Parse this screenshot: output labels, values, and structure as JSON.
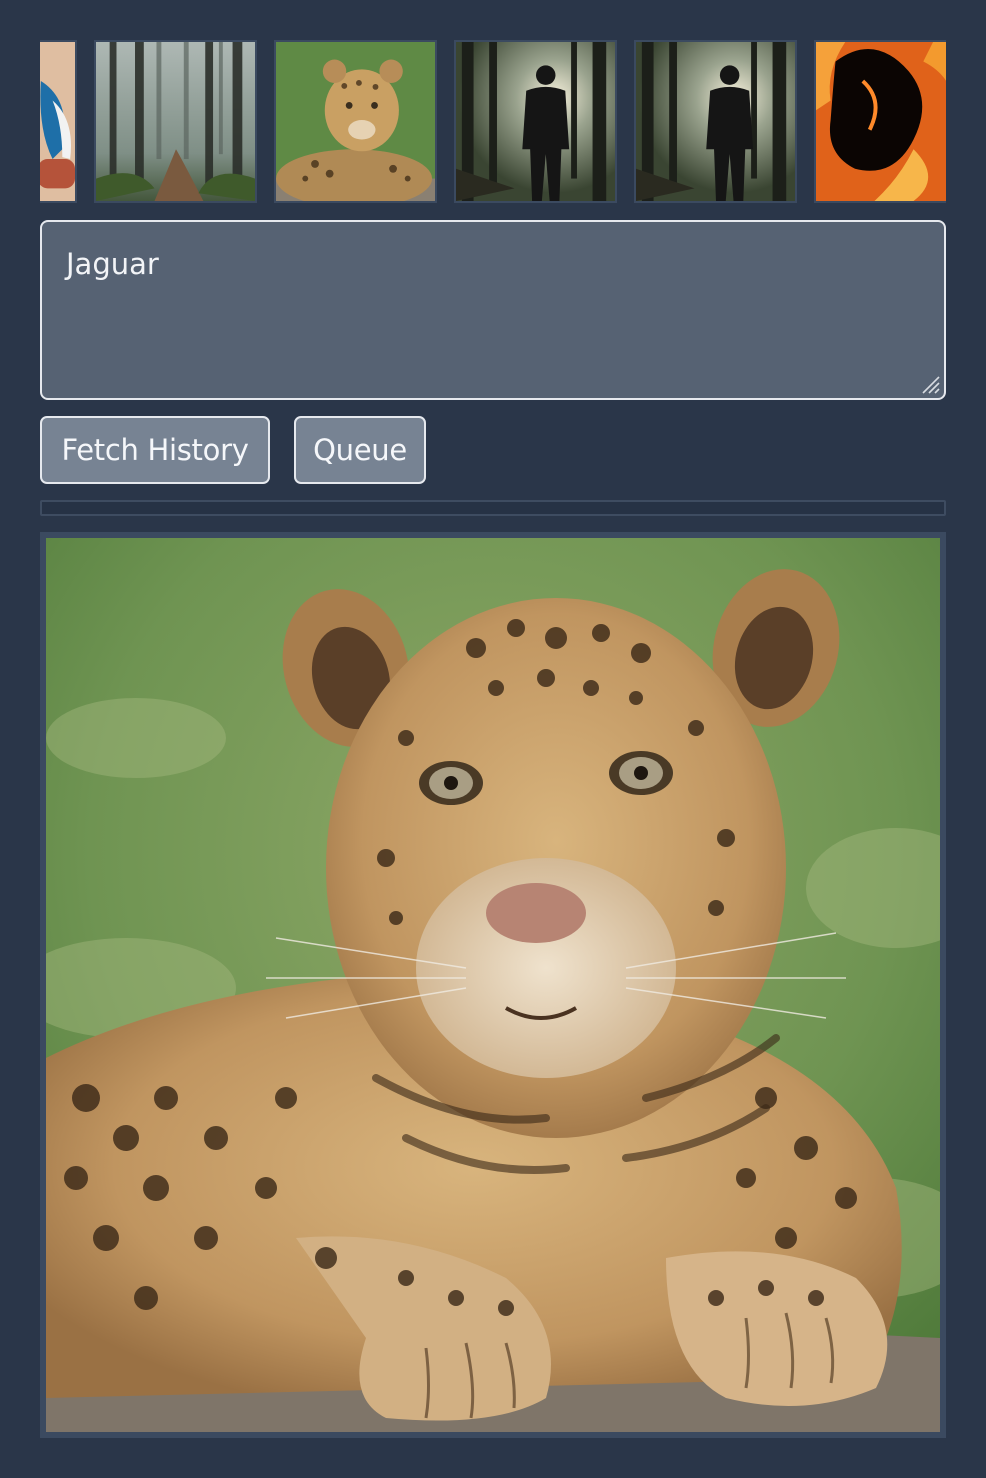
{
  "history": {
    "thumbnails": [
      {
        "subject": "bird-partial",
        "icon": "bird-thumbnail"
      },
      {
        "subject": "misty-forest-path",
        "icon": "forest-thumbnail"
      },
      {
        "subject": "jaguar",
        "icon": "jaguar-thumbnail"
      },
      {
        "subject": "silhouette-man-forest",
        "icon": "forest-silhouette-thumbnail"
      },
      {
        "subject": "silhouette-man-forest",
        "icon": "forest-silhouette-thumbnail"
      },
      {
        "subject": "fire",
        "icon": "fire-thumbnail"
      }
    ]
  },
  "prompt": {
    "value": "Jaguar",
    "placeholder": ""
  },
  "buttons": {
    "fetch_history": "Fetch History",
    "queue": "Queue"
  },
  "progress": {
    "fraction": 0
  },
  "colors": {
    "background": "#2a3649",
    "textarea_bg": "#566273",
    "button_bg": "#778393",
    "border_light": "#e6e9ee",
    "frame": "#3b4a60"
  }
}
